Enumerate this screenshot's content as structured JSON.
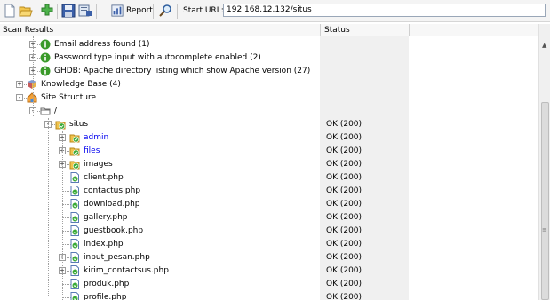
{
  "toolbar": {
    "report_label": "Report",
    "start_url_label": "Start URL:",
    "start_url_value": "192.168.12.132/situs",
    "icons": [
      "new-document-icon",
      "open-folder-icon",
      "add-plugin-icon",
      "save-icon",
      "export-icon",
      "report-icon",
      "search-icon"
    ]
  },
  "header": {
    "scan_results": "Scan Results",
    "status": "Status"
  },
  "tree": [
    {
      "level": 2,
      "expander": "+",
      "icon": "info-icon",
      "label": "Email address found (1)",
      "status": ""
    },
    {
      "level": 2,
      "expander": "+",
      "icon": "info-icon",
      "label": "Password type input with autocomplete enabled (2)",
      "status": ""
    },
    {
      "level": 2,
      "expander": "+",
      "icon": "info-icon",
      "label": "GHDB: Apache directory listing which show Apache version (27)",
      "status": ""
    },
    {
      "level": 1,
      "expander": "+",
      "icon": "knowledge-base-icon",
      "label": "Knowledge Base (4)",
      "status": ""
    },
    {
      "level": 1,
      "expander": "-",
      "icon": "site-structure-icon",
      "label": "Site Structure",
      "status": ""
    },
    {
      "level": 2,
      "expander": "-",
      "icon": "folder-icon",
      "label": "/",
      "status": ""
    },
    {
      "level": 3,
      "expander": "-",
      "icon": "folder-ok-icon",
      "label": "situs",
      "status": "OK (200)"
    },
    {
      "level": 4,
      "expander": "+",
      "icon": "folder-ok-icon",
      "label": "admin",
      "status": "OK (200)",
      "link": true
    },
    {
      "level": 4,
      "expander": "+",
      "icon": "folder-ok-icon",
      "label": "files",
      "status": "OK (200)",
      "link": true
    },
    {
      "level": 4,
      "expander": "+",
      "icon": "folder-ok-icon",
      "label": "images",
      "status": "OK (200)"
    },
    {
      "level": 4,
      "expander": "",
      "icon": "file-ok-icon",
      "label": "client.php",
      "status": "OK (200)"
    },
    {
      "level": 4,
      "expander": "",
      "icon": "file-ok-icon",
      "label": "contactus.php",
      "status": "OK (200)"
    },
    {
      "level": 4,
      "expander": "",
      "icon": "file-ok-icon",
      "label": "download.php",
      "status": "OK (200)"
    },
    {
      "level": 4,
      "expander": "",
      "icon": "file-ok-icon",
      "label": "gallery.php",
      "status": "OK (200)"
    },
    {
      "level": 4,
      "expander": "",
      "icon": "file-ok-icon",
      "label": "guestbook.php",
      "status": "OK (200)"
    },
    {
      "level": 4,
      "expander": "",
      "icon": "file-ok-icon",
      "label": "index.php",
      "status": "OK (200)"
    },
    {
      "level": 4,
      "expander": "+",
      "icon": "file-ok-icon",
      "label": "input_pesan.php",
      "status": "OK (200)"
    },
    {
      "level": 4,
      "expander": "+",
      "icon": "file-ok-icon",
      "label": "kirim_contactsus.php",
      "status": "OK (200)"
    },
    {
      "level": 4,
      "expander": "",
      "icon": "file-ok-icon",
      "label": "produk.php",
      "status": "OK (200)"
    },
    {
      "level": 4,
      "expander": "",
      "icon": "file-ok-icon",
      "label": "profile.php",
      "status": "OK (200)"
    }
  ],
  "colors": {
    "link": "#0000ee",
    "info": "#3a9a2a",
    "folder": "#e6b22e",
    "ok_badge": "#39a935"
  }
}
